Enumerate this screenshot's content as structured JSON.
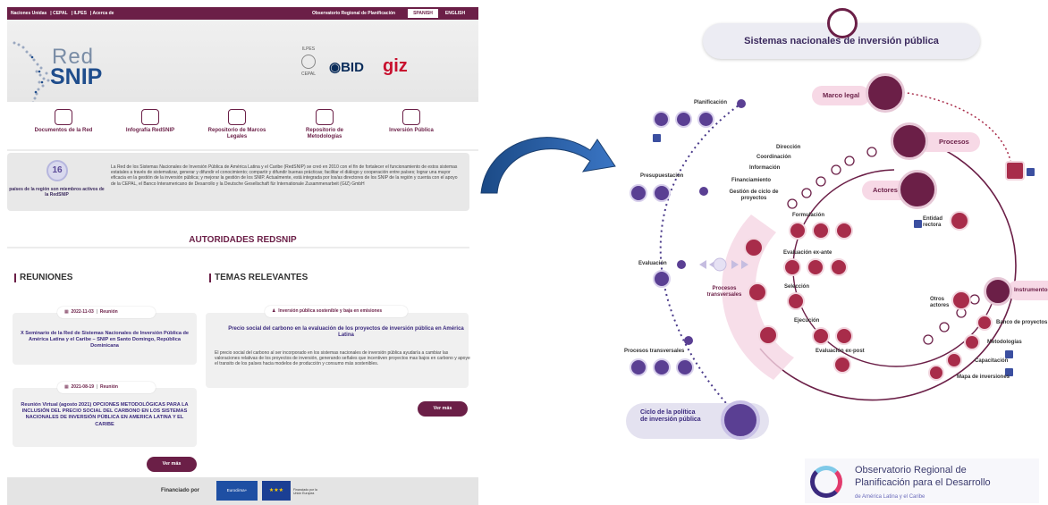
{
  "site": {
    "topbar": {
      "links": [
        "Naciones Unidas",
        "CEPAL",
        "ILPES",
        "Acerca de"
      ],
      "observatorio": "Observatorio Regional de Planificación",
      "lang_es": "SPANISH",
      "lang_en": "ENGLISH"
    },
    "logo": {
      "red": "Red",
      "snip": "SNIP"
    },
    "partners": {
      "cepal_top": "ILPES",
      "cepal_bottom": "CEPAL",
      "bid": "BID",
      "giz": "giz"
    },
    "nav": [
      {
        "label": "Documentos de la Red"
      },
      {
        "label": "Infografía RedSNIP"
      },
      {
        "label": "Repositorio de Marcos Legales"
      },
      {
        "label": "Repositorio de Metodologías"
      },
      {
        "label": "Inversión Pública"
      }
    ],
    "info": {
      "count": "16",
      "caption": "países de la región son miembros activos de la RedSNIP",
      "text": "La Red de los Sistemas Nacionales de Inversión Pública de América Latina y el Caribe (RedSNIP) se creó en 2010 con el fin de fortalecer el funcionamiento de estos sistemas estatales a través de sistematizar, generar y difundir el conocimiento; compartir y difundir buenas prácticas; facilitar el diálogo y cooperación entre países; lograr una mayor eficacia en la gestión de la inversión pública; y mejorar la gestión de los SNIP. Actualmente, está integrada por los/as directores de los SNIP de la región y cuenta con el apoyo de la CEPAL, el Banco Interamericano de Desarrollo y la Deutsche Gesellschaft für Internationale Zusammenarbeit (GIZ) GmbH"
    },
    "authorities_title": "AUTORIDADES REDSNIP",
    "reuniones": {
      "title": "REUNIONES",
      "items": [
        {
          "date": "2022-11-03",
          "type": "Reunión",
          "title": "X Seminario de la Red de Sistemas Nacionales de Inversión Pública de América Latina y el Caribe – SNIP en Santo Domingo, República Dominicana"
        },
        {
          "date": "2021-08-19",
          "type": "Reunión",
          "title": "Reunión Virtual (agosto 2021) OPCIONES METODOLÓGICAS PARA LA INCLUSIÓN DEL PRECIO SOCIAL DEL CARBONO EN LOS SISTEMAS NACIONALES DE INVERSIÓN PÚBLICA EN AMERICA LATINA Y EL CARIBE"
        }
      ],
      "more": "Ver más"
    },
    "temas": {
      "title": "TEMAS RELEVANTES",
      "chip": "Inversión pública sostenible y baja en emisiones",
      "card_title": "Precio social del carbono en la evaluación de los proyectos de inversión pública en América Latina",
      "card_body": "El precio social del carbono al ser incorporado en los sistemas nacionales de inversión pública ayudaría a cambiar las valoraciones relativas de los proyectos de inversión, generando señales que incentiven proyectos mas bajos en carbono y apoye el transito de los países hacia modelos de producción y consumo más sostenibles.",
      "more": "Ver más"
    },
    "footer": {
      "financed": "Financiado por",
      "euroclima": "Euroclima+",
      "eu_caption": "Financiado por la Unión Europea"
    }
  },
  "infographic": {
    "title": "Sistemas nacionales de inversión pública",
    "badges": {
      "marco": "Marco legal",
      "procesos": "Procesos",
      "actores": "Actores",
      "instrumentos": "Instrumentos"
    },
    "left_labels": {
      "planificacion": "Planificación",
      "presupuestacion": "Presupuestación",
      "evaluacion": "Evaluación",
      "procesos_transversales": "Procesos transversales"
    },
    "process_steps": [
      "Dirección",
      "Coordinación",
      "Información",
      "Financiamiento",
      "Gestión de ciclo de proyectos"
    ],
    "cycle_steps": [
      "Formulación",
      "Evaluación ex-ante",
      "Selección",
      "Ejecución",
      "Evaluación ex-post"
    ],
    "procesos_transversales_inner": "Procesos transversales",
    "actores_items": [
      "Entidad rectora",
      "Otros actores"
    ],
    "instrumentos_items": [
      "Banco de proyectos",
      "Metodologías",
      "Capacitación",
      "Mapa de inversiones"
    ],
    "cycle_box": "Ciclo de la política de inversión pública",
    "observatorio": {
      "line1": "Observatorio Regional de",
      "line2": "Planificación para el Desarrollo",
      "line3": "de América Latina y el Caribe"
    },
    "colors": {
      "maroon": "#6b1f47",
      "purple": "#5a3f93",
      "pink": "#f7d9e6"
    }
  }
}
